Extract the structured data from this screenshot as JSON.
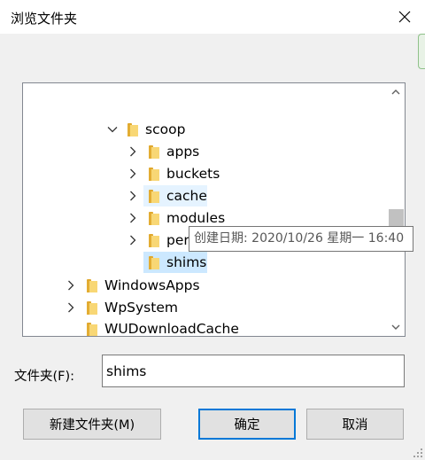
{
  "window": {
    "title": "浏览文件夹"
  },
  "tree": {
    "items": [
      {
        "label": "scoop",
        "expander": "expanded"
      },
      {
        "label": "apps",
        "expander": "collapsed"
      },
      {
        "label": "buckets",
        "expander": "collapsed"
      },
      {
        "label": "cache",
        "expander": "collapsed"
      },
      {
        "label": "modules",
        "expander": "collapsed"
      },
      {
        "label": "persist",
        "expander": "collapsed"
      },
      {
        "label": "shims",
        "expander": "none",
        "selected": true
      },
      {
        "label": "WindowsApps",
        "expander": "collapsed"
      },
      {
        "label": "WpSystem",
        "expander": "collapsed"
      },
      {
        "label": "WUDownloadCache",
        "expander": "none"
      }
    ]
  },
  "tooltip": {
    "text": "创建日期: 2020/10/26 星期一 16:40"
  },
  "folder": {
    "label": "文件夹(F):",
    "value": "shims"
  },
  "buttons": {
    "new_folder": "新建文件夹(M)",
    "ok": "确定",
    "cancel": "取消"
  },
  "colors": {
    "selection": "#cce8ff",
    "hover": "#e5f3ff",
    "default_button_border": "#0078d7",
    "folder_icon": "#f8d775"
  },
  "icons": {
    "close": "close-icon",
    "folder": "folder-icon",
    "expanded": "chevron-down-icon",
    "collapsed": "chevron-right-icon"
  }
}
